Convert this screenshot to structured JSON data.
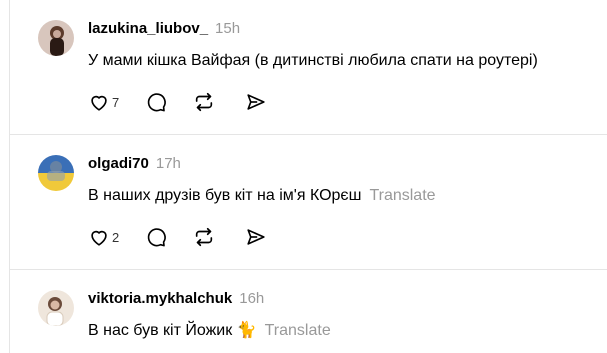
{
  "posts": [
    {
      "username": "lazukina_liubov_",
      "time": "15h",
      "text": "У мами кішка Вайфая (в дитинстві любила спати на роутері)",
      "translate": "",
      "likes": "7",
      "avatar_colors": [
        "#5b3a2a",
        "#c8a89a",
        "#2a1a14"
      ]
    },
    {
      "username": "olgadi70",
      "time": "17h",
      "text": "В наших друзів був кіт на ім'я КОрєш",
      "translate": "Translate",
      "likes": "2",
      "avatar_colors": [
        "#3a6fb7",
        "#f0c93a",
        "#7a8a9a"
      ]
    },
    {
      "username": "viktoria.mykhalchuk",
      "time": "16h",
      "text": "В нас був кіт Йожик 🐈",
      "translate": "Translate",
      "likes": "",
      "avatar_colors": [
        "#d9cbbb",
        "#6b4b3a",
        "#efe6dc"
      ]
    }
  ]
}
